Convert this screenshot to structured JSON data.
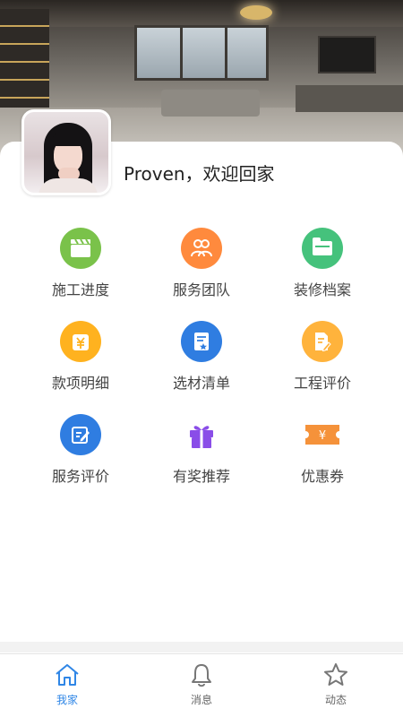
{
  "user": {
    "welcome_text": "Proven，欢迎回家"
  },
  "menu": [
    {
      "label": "施工进度",
      "icon": "clapperboard-icon",
      "color": "#7ac24a"
    },
    {
      "label": "服务团队",
      "icon": "team-icon",
      "color": "#ff8a3d"
    },
    {
      "label": "装修档案",
      "icon": "folder-icon",
      "color": "#45c27c"
    },
    {
      "label": "款项明细",
      "icon": "yen-wallet-icon",
      "color": "#ffb21f"
    },
    {
      "label": "选材清单",
      "icon": "list-doc-icon",
      "color": "#2f7de1"
    },
    {
      "label": "工程评价",
      "icon": "doc-edit-icon",
      "color": "#ffb33c"
    },
    {
      "label": "服务评价",
      "icon": "edit-icon",
      "color": "#2f7de1"
    },
    {
      "label": "有奖推荐",
      "icon": "gift-icon",
      "color": "#8a4de8"
    },
    {
      "label": "优惠券",
      "icon": "coupon-icon",
      "color": "#f5923a"
    }
  ],
  "tabs": [
    {
      "label": "我家",
      "icon": "home-icon",
      "active": true
    },
    {
      "label": "消息",
      "icon": "bell-icon",
      "active": false
    },
    {
      "label": "动态",
      "icon": "star-icon",
      "active": false
    }
  ],
  "colors": {
    "accent": "#2f86e6",
    "inactive": "#666666"
  }
}
